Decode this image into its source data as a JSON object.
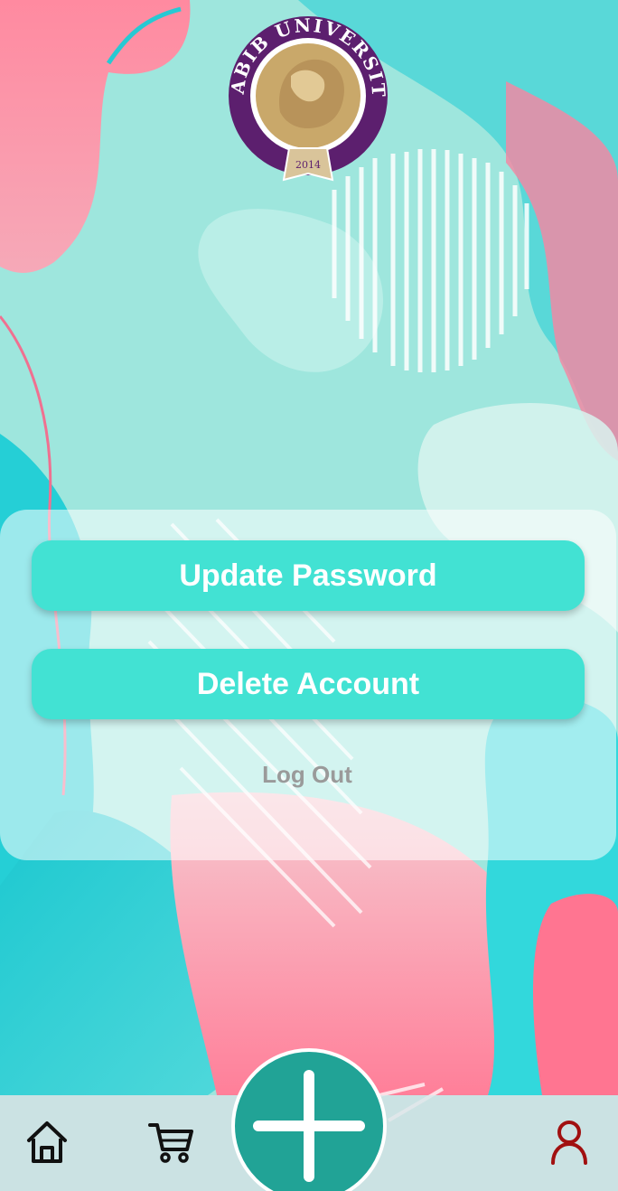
{
  "app": {
    "logo": {
      "text": "HABIB UNIVERSITY",
      "year": "2014",
      "icon": "lion-seal-icon"
    }
  },
  "account_menu": {
    "update_password_label": "Update Password",
    "delete_account_label": "Delete Account",
    "logout_label": "Log Out"
  },
  "bottom_nav": {
    "items": [
      {
        "icon": "home-icon"
      },
      {
        "icon": "cart-icon"
      },
      {
        "icon": "plus-icon"
      },
      {
        "icon": "user-icon"
      }
    ]
  },
  "colors": {
    "button": "#42e2d3",
    "fab": "#21a396",
    "profile_active": "#a11010",
    "logout_text": "#9a9a9a",
    "logo_purple": "#5c1f6e",
    "logo_gold": "#c9a86a"
  }
}
